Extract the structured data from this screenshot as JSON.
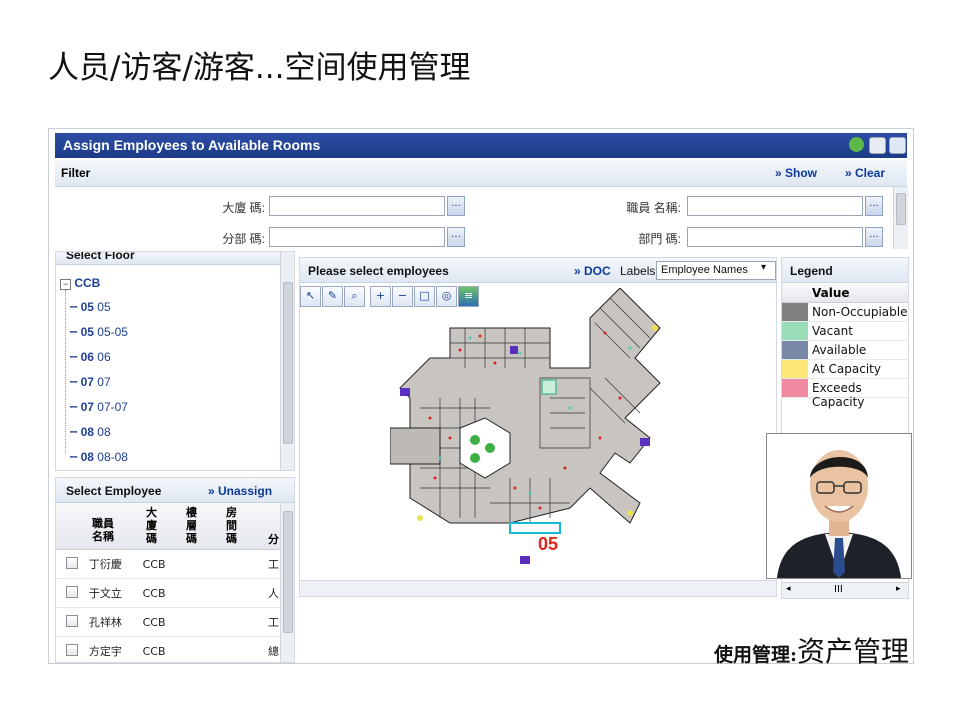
{
  "slide": {
    "title": "人员/访客/游客...空间使用管理",
    "footer_prefix": "使用管理:",
    "footer_main": "资产管理"
  },
  "app": {
    "window_title": "Assign Employees to Available Rooms",
    "filter": {
      "label": "Filter",
      "show": "» Show",
      "clear": "» Clear",
      "fields": [
        {
          "label": "大廈 碼:",
          "value": "",
          "dots": "..."
        },
        {
          "label": "職員 名稱:",
          "value": "",
          "dots": "..."
        },
        {
          "label": "分部 碼:",
          "value": "",
          "dots": "..."
        },
        {
          "label": "部門 碼:",
          "value": "",
          "dots": "..."
        }
      ]
    },
    "floor_panel": {
      "header": "Select Floor",
      "root": "CCB",
      "items": [
        {
          "code": "05",
          "name": "05"
        },
        {
          "code": "05",
          "name": "05-05"
        },
        {
          "code": "06",
          "name": "06"
        },
        {
          "code": "07",
          "name": "07"
        },
        {
          "code": "07",
          "name": "07-07"
        },
        {
          "code": "08",
          "name": "08"
        },
        {
          "code": "08",
          "name": "08-08"
        }
      ]
    },
    "employee_panel": {
      "header": "Select Employee",
      "unassign": "» Unassign",
      "columns": [
        "職員名稱",
        "大廈碼",
        "樓層碼",
        "房間碼",
        "分"
      ],
      "rows": [
        {
          "name": "丁衍慶",
          "building": "CCB",
          "floor": "",
          "room": "",
          "div": "工"
        },
        {
          "name": "于文立",
          "building": "CCB",
          "floor": "",
          "room": "",
          "div": "人"
        },
        {
          "name": "孔祥林",
          "building": "CCB",
          "floor": "",
          "room": "",
          "div": "工"
        },
        {
          "name": "方定宇",
          "building": "CCB",
          "floor": "",
          "room": "",
          "div": "總"
        }
      ]
    },
    "drawing_panel": {
      "header": "Please select employees",
      "doc": "» DOC",
      "labels_label": "Labels",
      "labels_value": "Employee Names",
      "floor_tag": "05",
      "tools": [
        "select-arrow-icon",
        "assign-icon",
        "zoom-icon",
        "zoom-in-icon",
        "zoom-out-icon",
        "zoom-window-icon",
        "zoom-extents-icon",
        "layers-icon"
      ]
    },
    "legend": {
      "header": "Legend",
      "column": "Value",
      "items": [
        {
          "label": "Non-Occupiable",
          "color": "#808080"
        },
        {
          "label": "Vacant",
          "color": "#99ddb8"
        },
        {
          "label": "Available",
          "color": "#7a88a8"
        },
        {
          "label": "At Capacity",
          "color": "#fde87a"
        },
        {
          "label": "Exceeds Capacity",
          "color": "#f18aa0"
        }
      ],
      "scroll_thumb": "III"
    }
  }
}
